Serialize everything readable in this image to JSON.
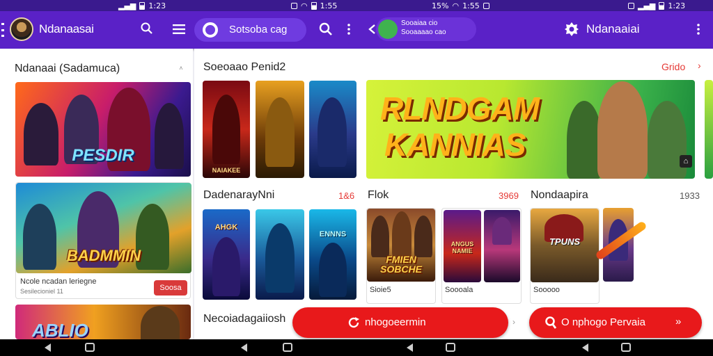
{
  "status_bar": {
    "times": [
      "1:23",
      "1:55",
      "1:55",
      "1:23"
    ],
    "battery": [
      "",
      "15%",
      "",
      ""
    ]
  },
  "left_app": {
    "title": "Ndanaasai",
    "search_icon": "search-icon",
    "menu_icon": "menu-icon",
    "section_title": "Ndanaai (Sadamuca)",
    "hero1_text": "PESDIR",
    "hero2_text": "BADMMIN",
    "card_title": "Ncole ncadan leriegne",
    "card_sub": "Sesilecioniel 11",
    "install_label": "Soosa",
    "hero3_text": "ABLIO"
  },
  "mid_app": {
    "pill_label": "Sotsoba cag",
    "section_title": "Soeoaao Penid2",
    "section2_title": "DadenarayNni",
    "section2_link": "1&6",
    "section3_title": "Necoiadagaiiosh",
    "posters": [
      "NAIAKEE",
      "",
      "",
      "AHGK",
      "",
      "ENNNS"
    ]
  },
  "chat_app": {
    "line1": "Sooaiaa cio",
    "line2": "Sooaaaao cao"
  },
  "right_app": {
    "title": "Ndanaaiai",
    "section_link": "Grido",
    "banner_text_1": "RLNDGAM",
    "banner_text_2": "KANNIAS",
    "flick_title": "Flok",
    "flick_link": "3969",
    "card1_text": "FMIEN SOBCHE",
    "card1_label": "Sioie5",
    "card2_label": "Soooala",
    "card2_poster": "ANGUS NAMIE",
    "card3_title": "Nondaapira",
    "card3_link": "1933",
    "card3_poster": "TPUNS",
    "card3_label": "Sooooo"
  },
  "fab_left": {
    "label": "nhogoeermin"
  },
  "fab_right": {
    "label": "O nphogo Pervaia"
  },
  "colors": {
    "accent": "#5a21c7",
    "primary_red": "#e8191b",
    "link_red": "#e53935"
  }
}
